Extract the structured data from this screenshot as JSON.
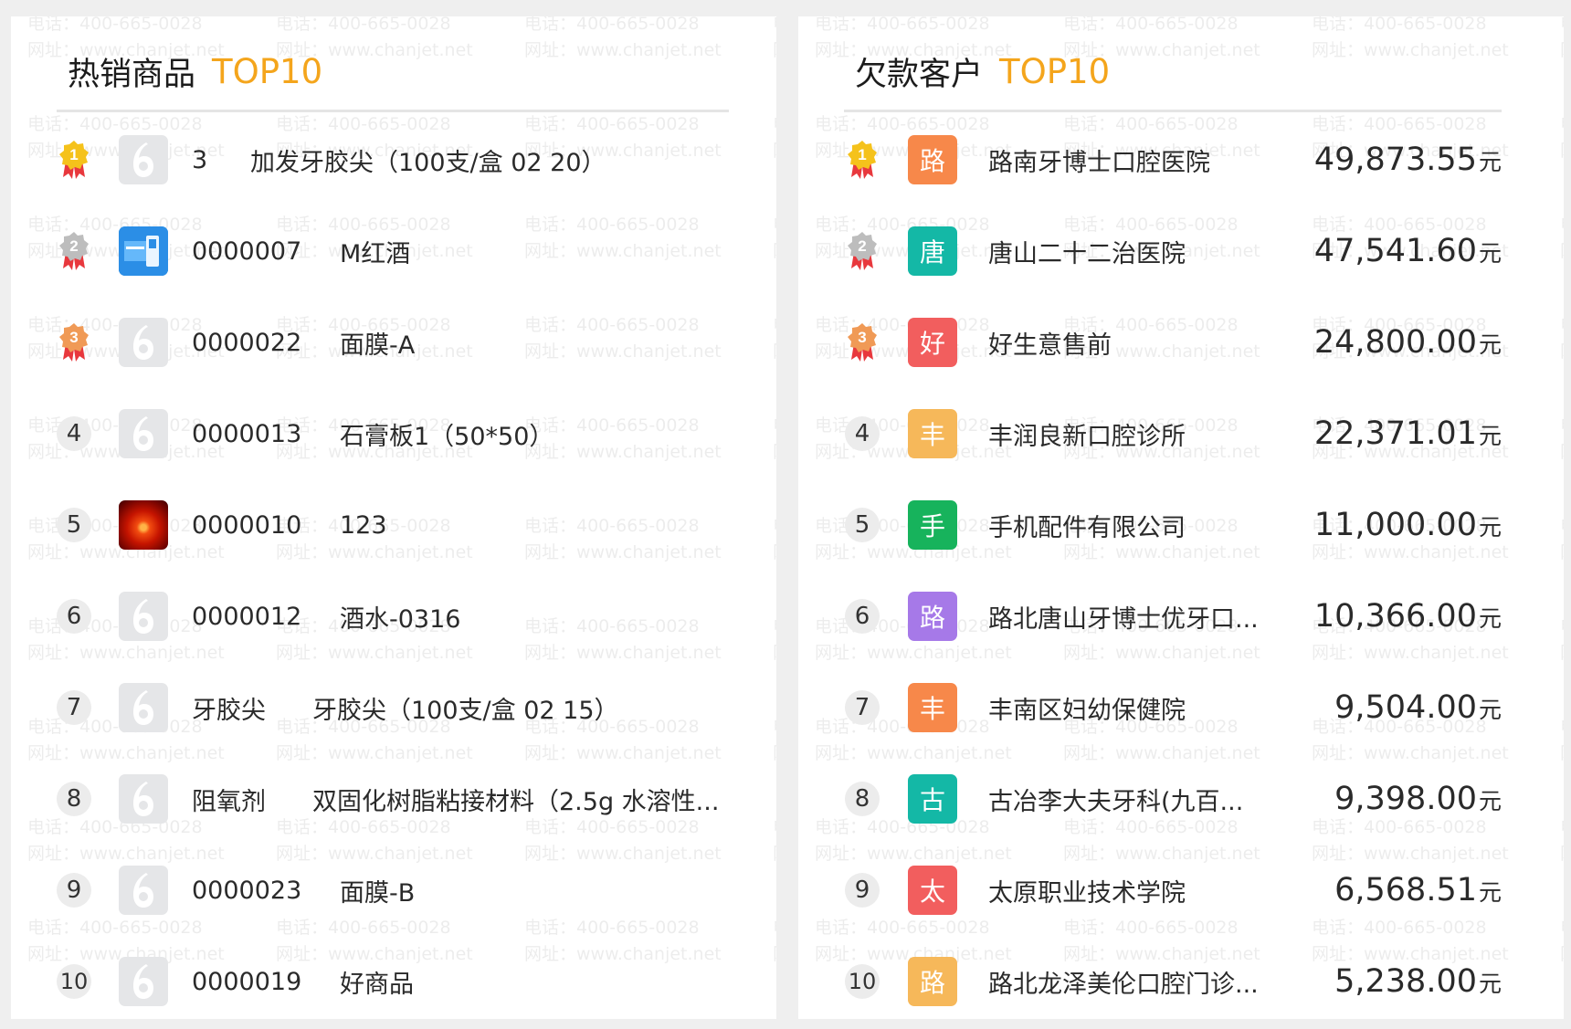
{
  "watermark": {
    "line1": "电话：400-665-0028",
    "line2": "网址：www.chanjet.net"
  },
  "colors": {
    "accent": "#f4a51c",
    "medal_gold": "#f5c21b",
    "medal_silver": "#bdbdbd",
    "medal_bronze": "#f09a56",
    "ribbon": "#e8383d"
  },
  "left_panel": {
    "title": "热销商品",
    "badge": "TOP10",
    "items": [
      {
        "rank": "1",
        "thumb": "placeholder-logo",
        "code": "3",
        "name": "加发牙胶尖（100支/盒 02 20）"
      },
      {
        "rank": "2",
        "thumb": "blue-product-photo",
        "code": "0000007",
        "name": "M红酒"
      },
      {
        "rank": "3",
        "thumb": "placeholder-logo",
        "code": "0000022",
        "name": "面膜-A"
      },
      {
        "rank": "4",
        "thumb": "placeholder-logo",
        "code": "0000013",
        "name": "石膏板1（50*50）"
      },
      {
        "rank": "5",
        "thumb": "red-flower-photo",
        "code": "0000010",
        "name": "123"
      },
      {
        "rank": "6",
        "thumb": "placeholder-logo",
        "code": "0000012",
        "name": "酒水-0316"
      },
      {
        "rank": "7",
        "thumb": "placeholder-logo",
        "code": "牙胶尖",
        "name": "牙胶尖（100支/盒 02 15）"
      },
      {
        "rank": "8",
        "thumb": "placeholder-logo",
        "code": "阻氧剂",
        "name": "双固化树脂粘接材料（2.5g 水溶性..."
      },
      {
        "rank": "9",
        "thumb": "placeholder-logo",
        "code": "0000023",
        "name": "面膜-B"
      },
      {
        "rank": "10",
        "thumb": "placeholder-logo",
        "code": "0000019",
        "name": "好商品"
      }
    ]
  },
  "right_panel": {
    "title": "欠款客户",
    "badge": "TOP10",
    "currency_unit": "元",
    "items": [
      {
        "rank": "1",
        "initial": "路",
        "color": "#f7884a",
        "name": "路南牙博士口腔医院",
        "amount": "49,873.55"
      },
      {
        "rank": "2",
        "initial": "唐",
        "color": "#14b8a6",
        "name": "唐山二十二治医院",
        "amount": "47,541.60"
      },
      {
        "rank": "3",
        "initial": "好",
        "color": "#f25e5e",
        "name": "好生意售前",
        "amount": "24,800.00"
      },
      {
        "rank": "4",
        "initial": "丰",
        "color": "#f6b85a",
        "name": "丰润良新口腔诊所",
        "amount": "22,371.01"
      },
      {
        "rank": "5",
        "initial": "手",
        "color": "#17b35c",
        "name": "手机配件有限公司",
        "amount": "11,000.00"
      },
      {
        "rank": "6",
        "initial": "路",
        "color": "#a679e8",
        "name": "路北唐山牙博士优牙口...",
        "amount": "10,366.00"
      },
      {
        "rank": "7",
        "initial": "丰",
        "color": "#f7884a",
        "name": "丰南区妇幼保健院",
        "amount": "9,504.00"
      },
      {
        "rank": "8",
        "initial": "古",
        "color": "#14b8a6",
        "name": "古冶李大夫牙科(九百...",
        "amount": "9,398.00"
      },
      {
        "rank": "9",
        "initial": "太",
        "color": "#f25e5e",
        "name": "太原职业技术学院",
        "amount": "6,568.51"
      },
      {
        "rank": "10",
        "initial": "路",
        "color": "#f6b85a",
        "name": "路北龙泽美伦口腔门诊...",
        "amount": "5,238.00"
      }
    ]
  }
}
